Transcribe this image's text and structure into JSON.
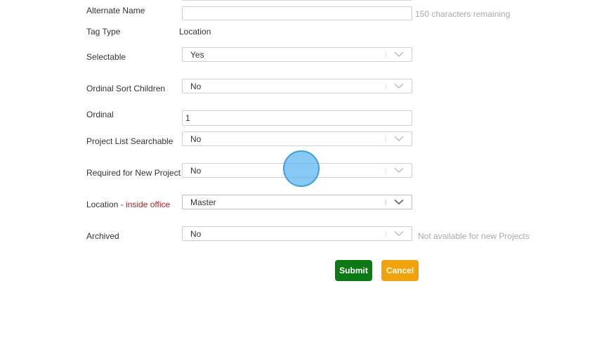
{
  "form": {
    "alternate_name": {
      "label": "Alternate Name",
      "value": "",
      "hint": "150 characters remaining"
    },
    "tag_type": {
      "label": "Tag Type",
      "value": "Location"
    },
    "selectable": {
      "label": "Selectable",
      "value": "Yes"
    },
    "ordinal_sort_children": {
      "label": "Ordinal Sort Children",
      "value": "No"
    },
    "ordinal": {
      "label": "Ordinal",
      "value": "1"
    },
    "project_list_searchable": {
      "label": "Project List Searchable",
      "value": "No"
    },
    "required_for_new_project": {
      "label": "Required for New Project",
      "value": "No"
    },
    "location": {
      "label": "Location",
      "label_sep": " - ",
      "label_highlight": "inside office",
      "value": "Master"
    },
    "archived": {
      "label": "Archived",
      "value": "No",
      "hint": "Not available for new Projects"
    }
  },
  "actions": {
    "submit_label": "Submit",
    "cancel_label": "Cancel"
  },
  "colors": {
    "submit": "#0b7a14",
    "cancel": "#f0a30a",
    "label_highlight": "#b22222",
    "hint": "#aaaaaa",
    "cursor_indicator": "#5ab4f0"
  },
  "icons": {
    "select_arrow": "chevron-down-icon"
  }
}
